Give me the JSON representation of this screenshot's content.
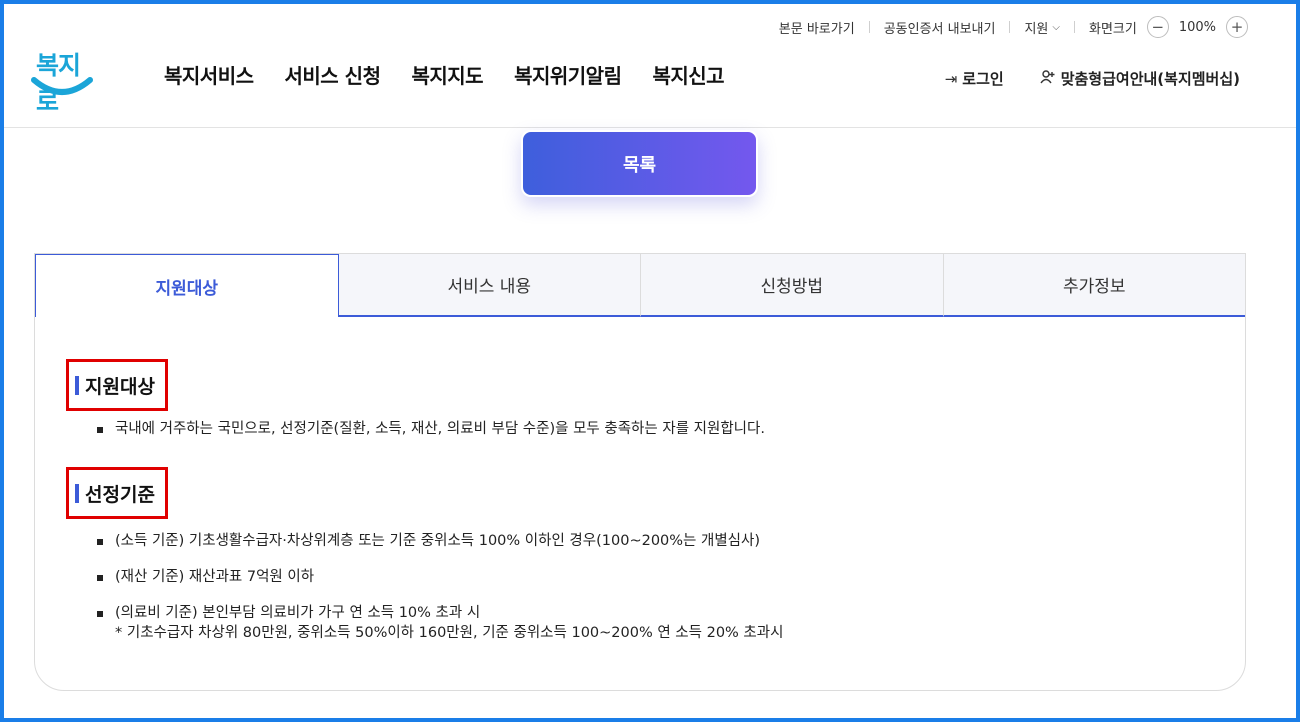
{
  "utility": {
    "skip": "본문 바로가기",
    "cert": "공동인증서 내보내기",
    "support": "지원",
    "zoom_label": "화면크기",
    "zoom_minus": "−",
    "zoom_value": "100%",
    "zoom_plus": "+"
  },
  "logo": {
    "text": "복지로"
  },
  "gnb": [
    "복지서비스",
    "서비스 신청",
    "복지지도",
    "복지위기알림",
    "복지신고"
  ],
  "member": {
    "login": "로그인",
    "membership": "맞춤형급여안내(복지멤버십)"
  },
  "list_button": "목록",
  "tabs": [
    {
      "label": "지원대상",
      "active": true
    },
    {
      "label": "서비스 내용",
      "active": false
    },
    {
      "label": "신청방법",
      "active": false
    },
    {
      "label": "추가정보",
      "active": false
    }
  ],
  "sections": {
    "target": {
      "title": "지원대상",
      "items": [
        "국내에 거주하는 국민으로, 선정기준(질환, 소득, 재산, 의료비 부담 수준)을 모두 충족하는 자를 지원합니다."
      ]
    },
    "criteria": {
      "title": "선정기준",
      "items": [
        "(소득 기준) 기초생활수급자·차상위계층 또는 기준 중위소득 100% 이하인 경우(100~200%는 개별심사)",
        "(재산 기준) 재산과표 7억원 이하",
        "(의료비 기준) 본인부담 의료비가 가구 연 소득 10% 초과 시"
      ],
      "note": "* 기초수급자 차상위 80만원, 중위소득 50%이하 160만원, 기준 중위소득 100~200% 연 소득 20% 초과시"
    }
  },
  "colors": {
    "accent": "#3c5bd8",
    "logo": "#1ba5d8",
    "highlight": "#e00000",
    "frame": "#1a7ee8"
  }
}
